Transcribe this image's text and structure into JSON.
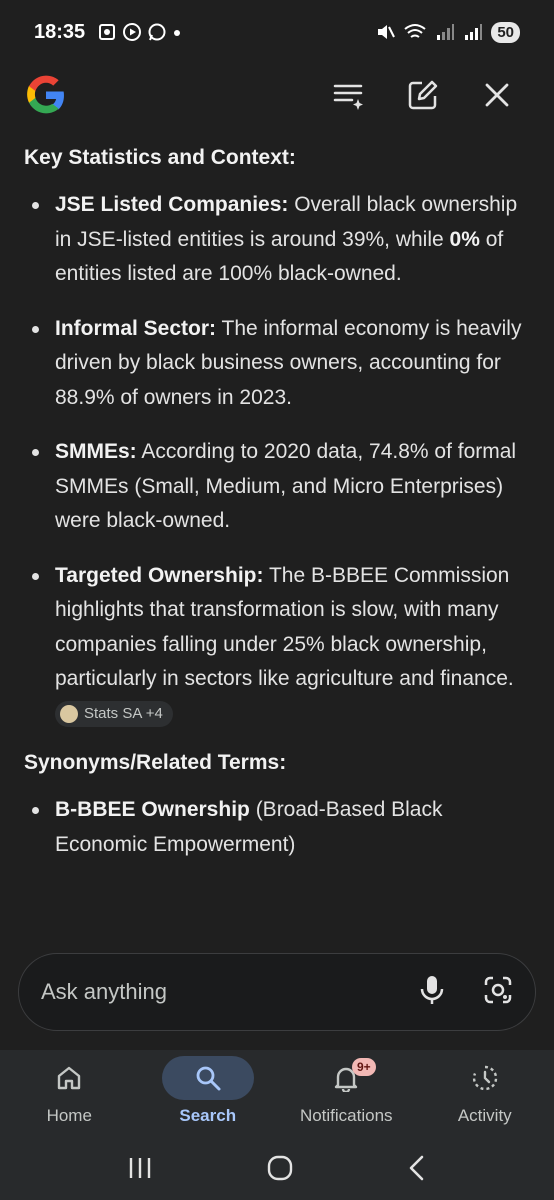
{
  "status_bar": {
    "time": "18:35",
    "battery": "50"
  },
  "header": {
    "logo": "google-g-logo",
    "icons": [
      "history-list-icon",
      "compose-icon",
      "close-icon"
    ]
  },
  "content": {
    "section1_heading": "Key Statistics and Context:",
    "bullets": [
      {
        "title": "JSE Listed Companies:",
        "text_a": " Overall black ownership in JSE-listed entities is around 39%, while ",
        "bold_mid": "0%",
        "text_b": " of entities listed are 100% black-owned."
      },
      {
        "title": "Informal Sector:",
        "text": " The informal economy is heavily driven by black business owners, accounting for 88.9% of owners in 2023."
      },
      {
        "title": "SMMEs:",
        "text": " According to 2020 data, 74.8% of formal SMMEs (Small, Medium, and Micro Enterprises) were black-owned."
      },
      {
        "title": "Targeted Ownership:",
        "text": " The B-BBEE Commission highlights that transformation is slow, with many companies falling under 25% black ownership, particularly in sectors like agriculture and finance. ",
        "source_chip": "Stats SA +4"
      }
    ],
    "section2_heading": "Synonyms/Related Terms:",
    "related": [
      {
        "title": "B-BBEE Ownership",
        "text": " (Broad-Based Black Economic Empowerment)"
      }
    ]
  },
  "ask_bar": {
    "placeholder": "Ask anything"
  },
  "bottom_nav": {
    "items": [
      {
        "label": "Home",
        "icon": "home-icon",
        "active": false
      },
      {
        "label": "Search",
        "icon": "search-icon",
        "active": true
      },
      {
        "label": "Notifications",
        "icon": "bell-icon",
        "active": false,
        "badge": "9+"
      },
      {
        "label": "Activity",
        "icon": "activity-icon",
        "active": false
      }
    ]
  },
  "colors": {
    "background": "#1f1f1f",
    "nav_background": "#282a2c",
    "accent": "#a8c7fa",
    "badge": "#f2b8b5"
  }
}
